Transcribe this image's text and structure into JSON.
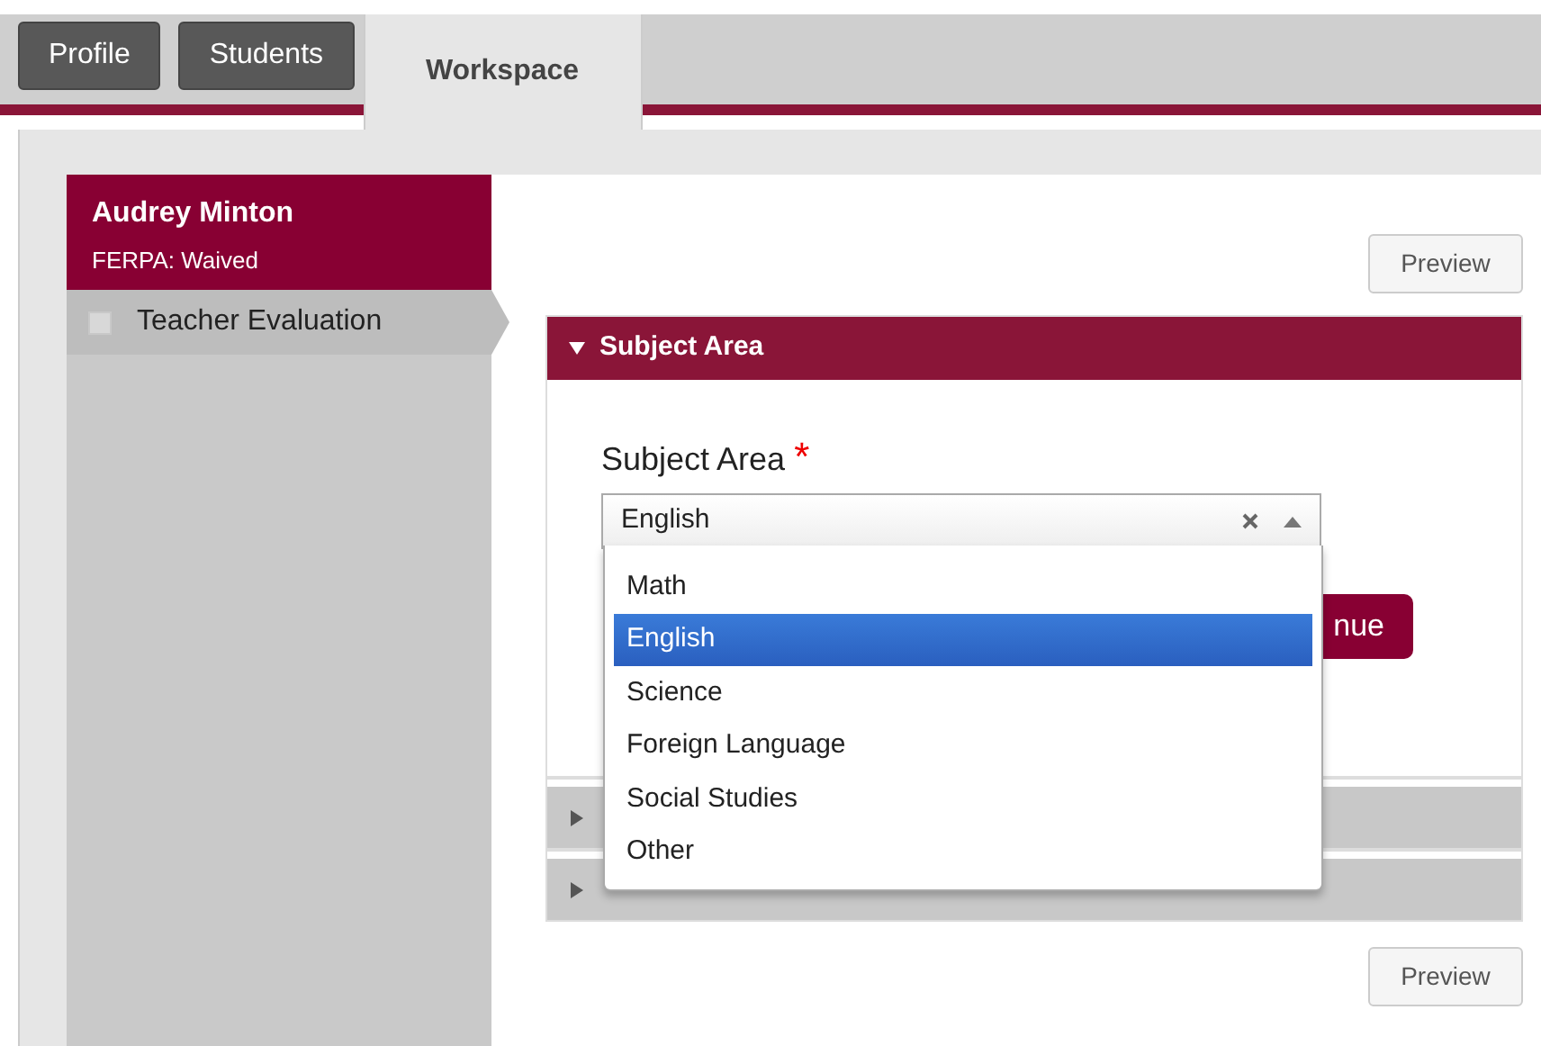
{
  "tabs": [
    {
      "label": "Profile",
      "selected": false
    },
    {
      "label": "Students",
      "selected": false
    },
    {
      "label": "Workspace",
      "selected": true
    }
  ],
  "student": {
    "name": "Audrey Minton",
    "ferpa": "FERPA: Waived"
  },
  "sidebar": {
    "items": [
      {
        "label": "Teacher Evaluation",
        "checked": false
      }
    ]
  },
  "preview_buttons": [
    "Preview",
    "Preview"
  ],
  "sections": [
    {
      "title": "Subject Area",
      "expanded": true
    },
    {
      "expanded": false
    },
    {
      "expanded": false
    }
  ],
  "field": {
    "label": "Subject Area",
    "required_mark": "*",
    "value": "English"
  },
  "continue_button": "nue",
  "dropdown": {
    "options": [
      {
        "label": "Math",
        "selected": false
      },
      {
        "label": "English",
        "selected": true
      },
      {
        "label": "Science",
        "selected": false
      },
      {
        "label": "Foreign Language",
        "selected": false
      },
      {
        "label": "Social Studies",
        "selected": false
      },
      {
        "label": "Other",
        "selected": false
      }
    ]
  }
}
